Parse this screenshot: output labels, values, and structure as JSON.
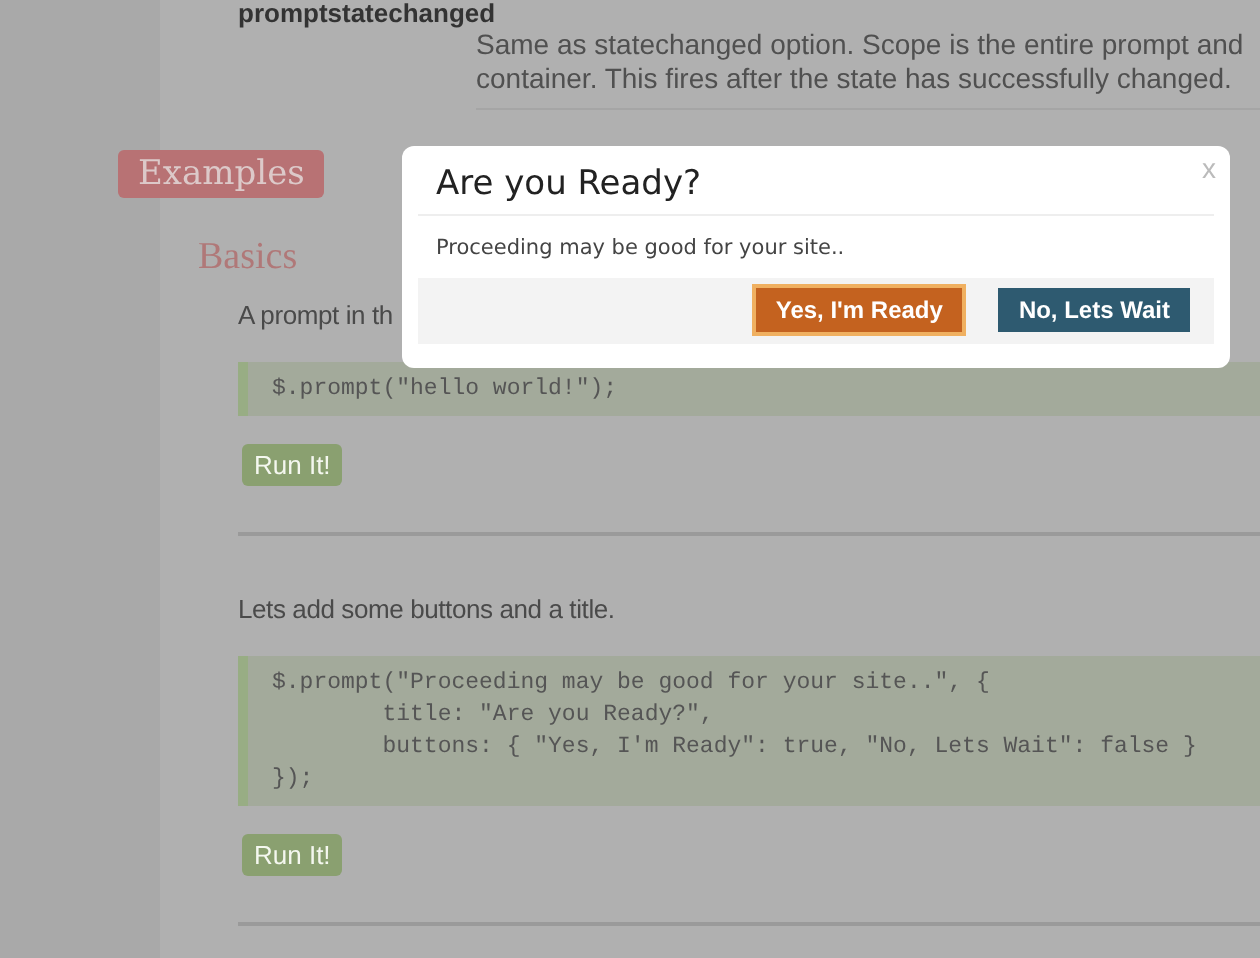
{
  "option": {
    "name": "promptstatechanged",
    "description": "Same as statechanged option. Scope is the entire prompt and container. This fires after the state has successfully changed."
  },
  "section_badge": "Examples",
  "subsection": "Basics",
  "examples": [
    {
      "intro": "A prompt in th",
      "code": [
        "$.prompt(\"hello world!\");"
      ],
      "button": "Run It!"
    },
    {
      "intro": "Lets add some buttons and a title.",
      "code": [
        "$.prompt(\"Proceeding may be good for your site..\", {",
        "        title: \"Are you Ready?\",",
        "        buttons: { \"Yes, I'm Ready\": true, \"No, Lets Wait\": false }",
        "});"
      ],
      "button": "Run It!"
    }
  ],
  "dialog": {
    "title": "Are you Ready?",
    "close": "x",
    "message": "Proceeding may be good for your site..",
    "buttons": [
      {
        "label": "Yes, I'm Ready",
        "kind": "primary"
      },
      {
        "label": "No, Lets Wait",
        "kind": "secondary"
      }
    ]
  }
}
